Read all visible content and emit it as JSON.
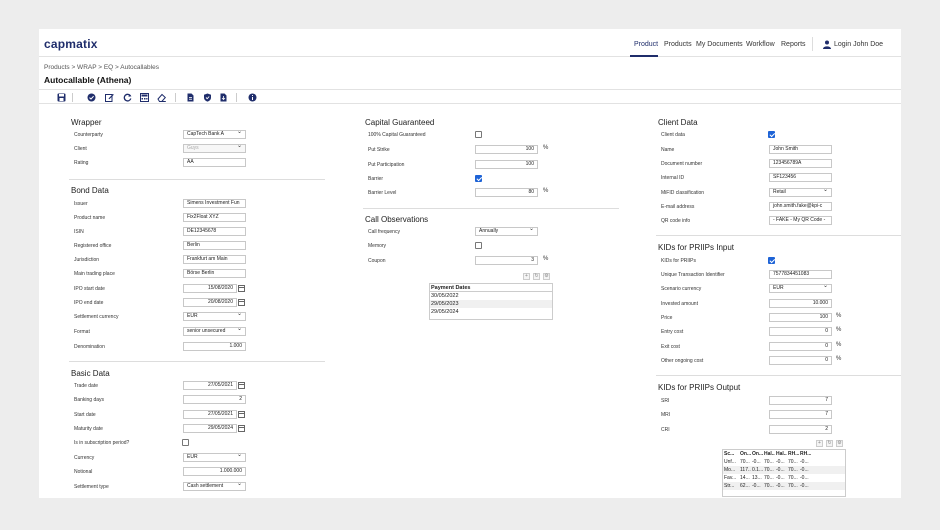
{
  "app": {
    "logo": "capmatix",
    "nav": [
      "Product",
      "Products",
      "My Documents",
      "Workflow",
      "Reports"
    ],
    "login": "Login John Doe"
  },
  "breadcrumb": "Products > WRAP > EQ > Autocallables",
  "title": "Autocallable (Athena)",
  "colors": {
    "brand": "#1f2d6b",
    "checkbox": "#1e63d6"
  },
  "toolbar_icons": [
    "save-icon",
    "check-icon",
    "edit-icon",
    "refresh-icon",
    "calculator-icon",
    "eraser-icon",
    "document-icon",
    "shield-icon",
    "download-icon",
    "info-icon"
  ],
  "wrapper": {
    "title": "Wrapper",
    "counterparty": {
      "label": "Counterparty",
      "value": "CapTech Bank A"
    },
    "client": {
      "label": "Client",
      "value": "Guys"
    },
    "rating": {
      "label": "Rating",
      "value": "AA"
    }
  },
  "bond": {
    "title": "Bond Data",
    "issuer": {
      "label": "Issuer",
      "value": "Simens Investment Fun"
    },
    "product_name": {
      "label": "Product name",
      "value": "Fix2Float XYZ"
    },
    "isin": {
      "label": "ISIN",
      "value": "DE12345678"
    },
    "registered_office": {
      "label": "Registered office",
      "value": "Berlin"
    },
    "jurisdiction": {
      "label": "Jurisdiction",
      "value": "Frankfurt am Main"
    },
    "main_trading_place": {
      "label": "Main trading place",
      "value": "Börse Berlin"
    },
    "ipo_start": {
      "label": "IPO start date",
      "value": "15/08/2020"
    },
    "ipo_end": {
      "label": "IPO end date",
      "value": "20/08/2020"
    },
    "settlement_currency": {
      "label": "Settlement currency",
      "value": "EUR"
    },
    "format": {
      "label": "Format",
      "value": "senior unsecured"
    },
    "denomination": {
      "label": "Denomination",
      "value": "1.000"
    }
  },
  "basic": {
    "title": "Basic Data",
    "trade_date": {
      "label": "Trade date",
      "value": "27/05/2021"
    },
    "banking_days": {
      "label": "Banking days",
      "value": "2"
    },
    "start_date": {
      "label": "Start date",
      "value": "27/05/2021"
    },
    "maturity_date": {
      "label": "Maturity date",
      "value": "29/05/2024"
    },
    "subscription": {
      "label": "Is in subscription period?",
      "checked": false
    },
    "currency": {
      "label": "Currency",
      "value": "EUR"
    },
    "notional": {
      "label": "Notional",
      "value": "1.000.000"
    },
    "settlement_type": {
      "label": "Settlement type",
      "value": "Cash settlement"
    }
  },
  "capital": {
    "title": "Capital Guaranteed",
    "guaranteed": {
      "label": "100% Capital Guaranteed",
      "checked": false
    },
    "put_strike": {
      "label": "Put Strike",
      "value": "100",
      "unit": "%"
    },
    "put_participation": {
      "label": "Put Participation",
      "value": "100"
    },
    "barrier": {
      "label": "Barrier",
      "checked": true
    },
    "barrier_level": {
      "label": "Barrier Level",
      "value": "80",
      "unit": "%"
    }
  },
  "call": {
    "title": "Call Observations",
    "frequency": {
      "label": "Call frequency",
      "value": "Annually"
    },
    "memory": {
      "label": "Memory",
      "checked": false
    },
    "coupon": {
      "label": "Coupon",
      "value": "3",
      "unit": "%"
    },
    "payment_header": "Payment Dates",
    "payment_dates": [
      "30/05/2022",
      "29/05/2023",
      "29/05/2024"
    ]
  },
  "client": {
    "title": "Client Data",
    "client_data": {
      "label": "Client data",
      "checked": true
    },
    "name": {
      "label": "Name",
      "value": "John Smith"
    },
    "document_number": {
      "label": "Document number",
      "value": "123456789A"
    },
    "internal_id": {
      "label": "Internal ID",
      "value": "SF123456"
    },
    "mifid": {
      "label": "MiFID classification",
      "value": "Retail"
    },
    "email": {
      "label": "E-mail address",
      "value": "john.smith.fake@kpi-c"
    },
    "qr": {
      "label": "QR code info",
      "value": "- FAKE - My QR Code -"
    }
  },
  "kid_input": {
    "title": "KIDs for PRIIPs Input",
    "kids": {
      "label": "KIDs for PRIIPs",
      "checked": true
    },
    "uti": {
      "label": "Unique Transaction Identifier",
      "value": "7577834451083"
    },
    "scenario_currency": {
      "label": "Scenario currency",
      "value": "EUR"
    },
    "invested_amount": {
      "label": "Invested amount",
      "value": "10.000"
    },
    "price": {
      "label": "Price",
      "value": "100",
      "unit": "%"
    },
    "entry_cost": {
      "label": "Entry cost",
      "value": "0",
      "unit": "%"
    },
    "exit_cost": {
      "label": "Exit cost",
      "value": "0",
      "unit": "%"
    },
    "ongoing_cost": {
      "label": "Other ongoing cost",
      "value": "0",
      "unit": "%"
    }
  },
  "kid_output": {
    "title": "KIDs for PRIIPs Output",
    "sri": {
      "label": "SRI",
      "value": "7"
    },
    "mrm": {
      "label": "MRI",
      "value": "7"
    },
    "cri": {
      "label": "CRI",
      "value": "2"
    },
    "grid_header": [
      "Sc...",
      "On...",
      "On...",
      "Hal...",
      "Hal...",
      "RH...",
      "RH..."
    ],
    "grid_rows": [
      [
        "Unf...",
        "70...",
        "-0...",
        "70...",
        "-0...",
        "70...",
        "-0..."
      ],
      [
        "Mo...",
        "117...",
        "0.1...",
        "70...",
        "-0...",
        "70...",
        "-0..."
      ],
      [
        "Fav...",
        "14...",
        "13...",
        "70...",
        "-0...",
        "70...",
        "-0..."
      ],
      [
        "Str...",
        "62...",
        "-0...",
        "70...",
        "-0...",
        "70...",
        "-0..."
      ]
    ]
  }
}
